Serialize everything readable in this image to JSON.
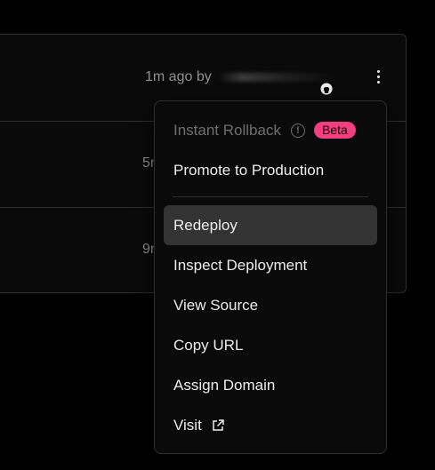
{
  "rows": [
    {
      "meta": "1m ago by"
    },
    {
      "meta": "5r"
    },
    {
      "meta": "9r"
    }
  ],
  "menu": {
    "instant_rollback": "Instant Rollback",
    "beta_badge": "Beta",
    "promote": "Promote to Production",
    "redeploy": "Redeploy",
    "inspect": "Inspect Deployment",
    "view_source": "View Source",
    "copy_url": "Copy URL",
    "assign_domain": "Assign Domain",
    "visit": "Visit"
  },
  "colors": {
    "beta_badge": "#f33f7f",
    "active_item": "#333333",
    "border": "#2e2e2e"
  },
  "icons": {
    "info": "info-icon",
    "github": "github-icon",
    "kebab": "more-vertical-icon",
    "external": "external-link-icon"
  }
}
